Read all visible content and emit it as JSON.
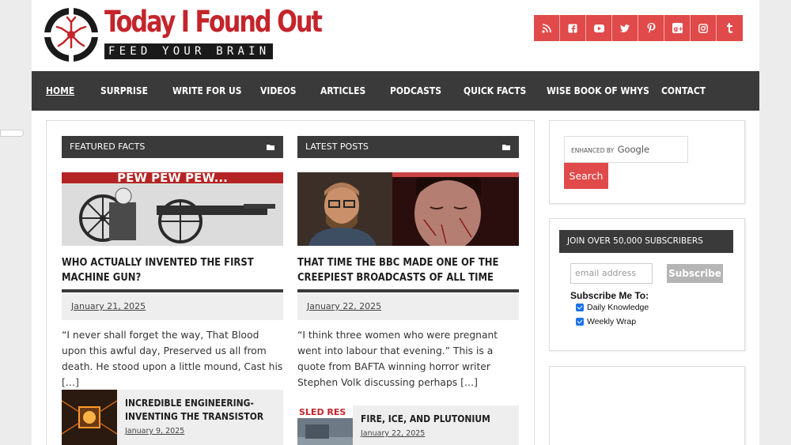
{
  "header": {
    "brand_name": "Today I Found Out",
    "tagline": "FEED YOUR BRAIN",
    "social_icons": [
      {
        "name": "rss-icon",
        "glyph": "∶"
      },
      {
        "name": "facebook-icon",
        "glyph": "f"
      },
      {
        "name": "youtube-icon",
        "glyph": "▶"
      },
      {
        "name": "twitter-icon",
        "glyph": "t"
      },
      {
        "name": "pinterest-icon",
        "glyph": "p"
      },
      {
        "name": "google-plus-icon",
        "glyph": "g+"
      },
      {
        "name": "instagram-icon",
        "glyph": "◎"
      },
      {
        "name": "tumblr-icon",
        "glyph": "t"
      }
    ]
  },
  "nav": {
    "items": [
      "HOME",
      "SURPRISE",
      "WRITE FOR US",
      "VIDEOS",
      "ARTICLES",
      "PODCASTS",
      "QUICK FACTS",
      "WISE BOOK OF WHYS",
      "CONTACT"
    ]
  },
  "featured": {
    "heading": "FEATURED FACTS",
    "image_text": "PEW PEW PEW...",
    "title": "WHO ACTUALLY INVENTED THE FIRST MACHINE GUN?",
    "date": "January 21, 2025",
    "excerpt": "“I never shall forget the way, That Blood upon this awful day, Preserved us all from death. He stood upon a little mound, Cast his […]",
    "mini": {
      "title": "INCREDIBLE ENGINEERING- INVENTING THE TRANSISTOR",
      "date": "January 9, 2025"
    }
  },
  "latest": {
    "heading": "LATEST POSTS",
    "title": "THAT TIME THE BBC MADE ONE OF THE CREEPIEST BROADCASTS OF ALL TIME",
    "date": "January 22, 2025",
    "excerpt": "“I think three women who were pregnant went into labour that evening.” This is a quote from BAFTA winning horror writer Stephen Volk discussing perhaps […]",
    "mini": {
      "title": "FIRE, ICE, AND PLUTONIUM",
      "date": "January 22, 2025",
      "image_text": "SLED RES"
    }
  },
  "sidebar": {
    "search_prefix": "ENHANCED BY",
    "search_brand": "Google",
    "search_button": "Search",
    "subscribe": {
      "heading": "JOIN OVER 50,000 SUBSCRIBERS",
      "email_placeholder": "email address",
      "button": "Subscribe",
      "label": "Subscribe Me To:",
      "options": [
        "Daily Knowledge",
        "Weekly Wrap"
      ]
    }
  },
  "colors": {
    "accent": "#e04a4a",
    "dark": "#3a3a3a",
    "brand_red": "#c4242b"
  }
}
